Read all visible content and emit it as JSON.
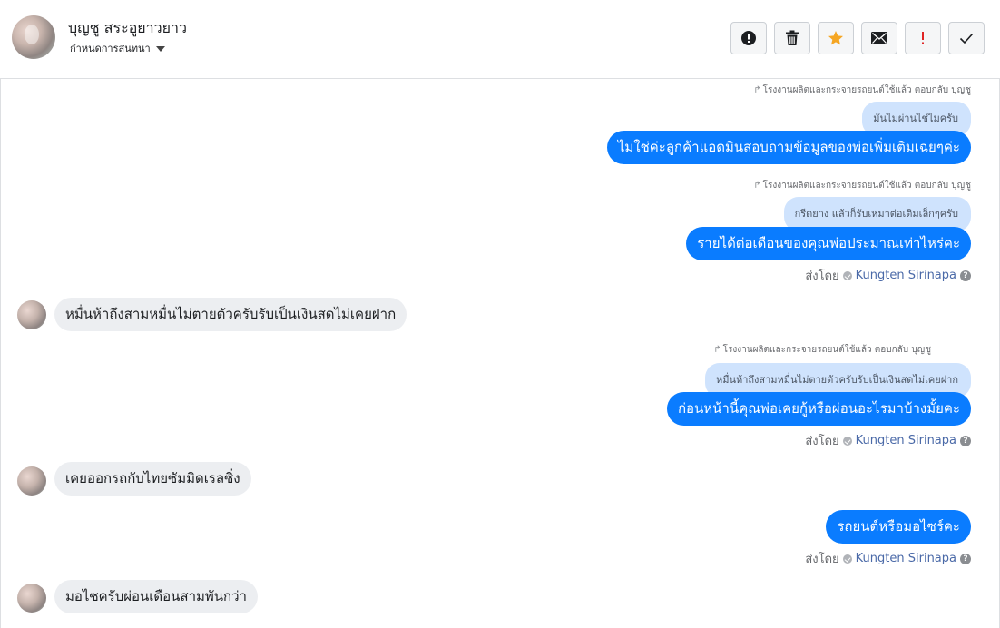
{
  "contact": {
    "name": "บุญชู สระอูยาวยาว",
    "subtitle": "กำหนดการสนทนา"
  },
  "toolbar": {
    "buttons": [
      {
        "icon": "alert-circle-icon",
        "color": "#1c1e21"
      },
      {
        "icon": "trash-icon",
        "color": "#1c1e21"
      },
      {
        "icon": "star-icon",
        "color": "#f5a623"
      },
      {
        "icon": "envelope-icon",
        "color": "#1c1e21"
      },
      {
        "icon": "exclamation-icon",
        "color": "#e02424"
      },
      {
        "icon": "checkmark-icon",
        "color": "#1c1e21"
      }
    ]
  },
  "colors": {
    "outgoing_bubble": "#0a7cff",
    "incoming_bubble": "#eceef1",
    "quoted_bubble": "#cfe3fd",
    "sender_name": "#4b6aa8"
  },
  "messages": {
    "m1": {
      "reply_note": "โรงงานผลิตและกระจายรถยนต์ใช้แล้ว ตอบกลับ บุญชู",
      "quoted": "มันไม่ผ่านไช่ไมครับ",
      "text": "ไม่ใช่ค่ะลูกค้าแอดมินสอบถามข้อมูลของพ่อเพิ่มเติมเฉยๆค่ะ"
    },
    "m2": {
      "reply_note": "โรงงานผลิตและกระจายรถยนต์ใช้แล้ว ตอบกลับ บุญชู",
      "quoted": "กรีดยาง แล้วก็รับเหมาต่อเติมเล็กๆครับ",
      "text": "รายได้ต่อเดือนของคุณพ่อประมาณเท่าไหร่คะ",
      "sent_by_label": "ส่งโดย",
      "sender": "Kungten Sirinapa"
    },
    "m3": {
      "text": "หมื่นห้าถึงสามหมื่นไม่ตายตัวครับรับเป็นเงินสดไม่เคยฝาก"
    },
    "m4": {
      "reply_note": "โรงงานผลิตและกระจายรถยนต์ใช้แล้ว ตอบกลับ บุญชู",
      "quoted": "หมื่นห้าถึงสามหมื่นไม่ตายตัวครับรับเป็นเงินสดไม่เคยฝาก",
      "text": "ก่อนหน้านี้คุณพ่อเคยกู้หรือผ่อนอะไรมาบ้างมั้ยคะ",
      "sent_by_label": "ส่งโดย",
      "sender": "Kungten Sirinapa"
    },
    "m5": {
      "text": "เคยออกรถกับไทยซัมมิดเรลซิ่ง"
    },
    "m6": {
      "text": "รถยนต์หรือมอไซร์คะ",
      "sent_by_label": "ส่งโดย",
      "sender": "Kungten Sirinapa"
    },
    "m7": {
      "text": "มอไซครับผ่อนเดือนสามพันกว่า"
    }
  }
}
